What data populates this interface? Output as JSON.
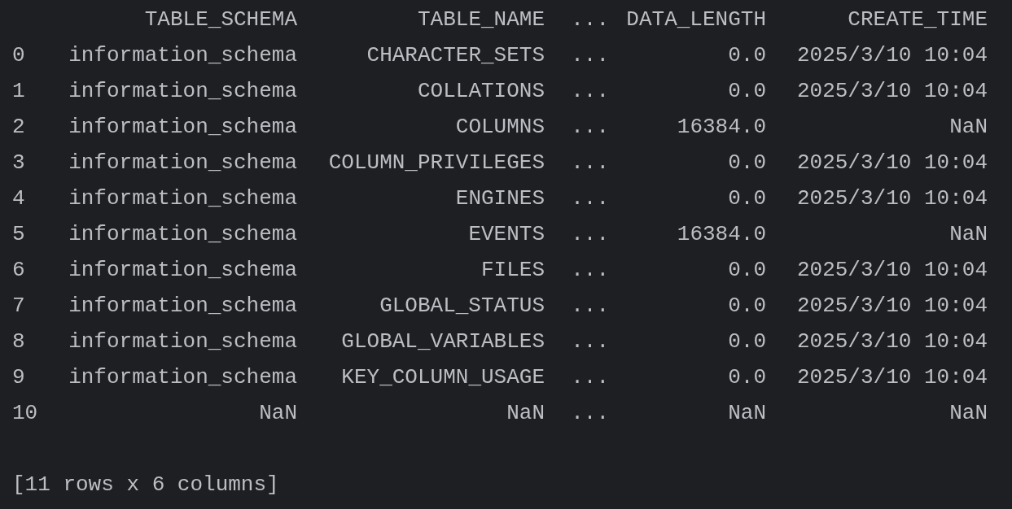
{
  "table": {
    "columns": [
      "TABLE_SCHEMA",
      "TABLE_NAME",
      "...",
      "DATA_LENGTH",
      "CREATE_TIME"
    ],
    "rows": [
      {
        "index": "0",
        "cells": [
          "information_schema",
          "CHARACTER_SETS",
          "...",
          "0.0",
          "2025/3/10 10:04"
        ]
      },
      {
        "index": "1",
        "cells": [
          "information_schema",
          "COLLATIONS",
          "...",
          "0.0",
          "2025/3/10 10:04"
        ]
      },
      {
        "index": "2",
        "cells": [
          "information_schema",
          "COLUMNS",
          "...",
          "16384.0",
          "NaN"
        ]
      },
      {
        "index": "3",
        "cells": [
          "information_schema",
          "COLUMN_PRIVILEGES",
          "...",
          "0.0",
          "2025/3/10 10:04"
        ]
      },
      {
        "index": "4",
        "cells": [
          "information_schema",
          "ENGINES",
          "...",
          "0.0",
          "2025/3/10 10:04"
        ]
      },
      {
        "index": "5",
        "cells": [
          "information_schema",
          "EVENTS",
          "...",
          "16384.0",
          "NaN"
        ]
      },
      {
        "index": "6",
        "cells": [
          "information_schema",
          "FILES",
          "...",
          "0.0",
          "2025/3/10 10:04"
        ]
      },
      {
        "index": "7",
        "cells": [
          "information_schema",
          "GLOBAL_STATUS",
          "...",
          "0.0",
          "2025/3/10 10:04"
        ]
      },
      {
        "index": "8",
        "cells": [
          "information_schema",
          "GLOBAL_VARIABLES",
          "...",
          "0.0",
          "2025/3/10 10:04"
        ]
      },
      {
        "index": "9",
        "cells": [
          "information_schema",
          "KEY_COLUMN_USAGE",
          "...",
          "0.0",
          "2025/3/10 10:04"
        ]
      },
      {
        "index": "10",
        "cells": [
          "NaN",
          "NaN",
          "...",
          "NaN",
          "NaN"
        ]
      }
    ]
  },
  "summary": "[11 rows x 6 columns]"
}
